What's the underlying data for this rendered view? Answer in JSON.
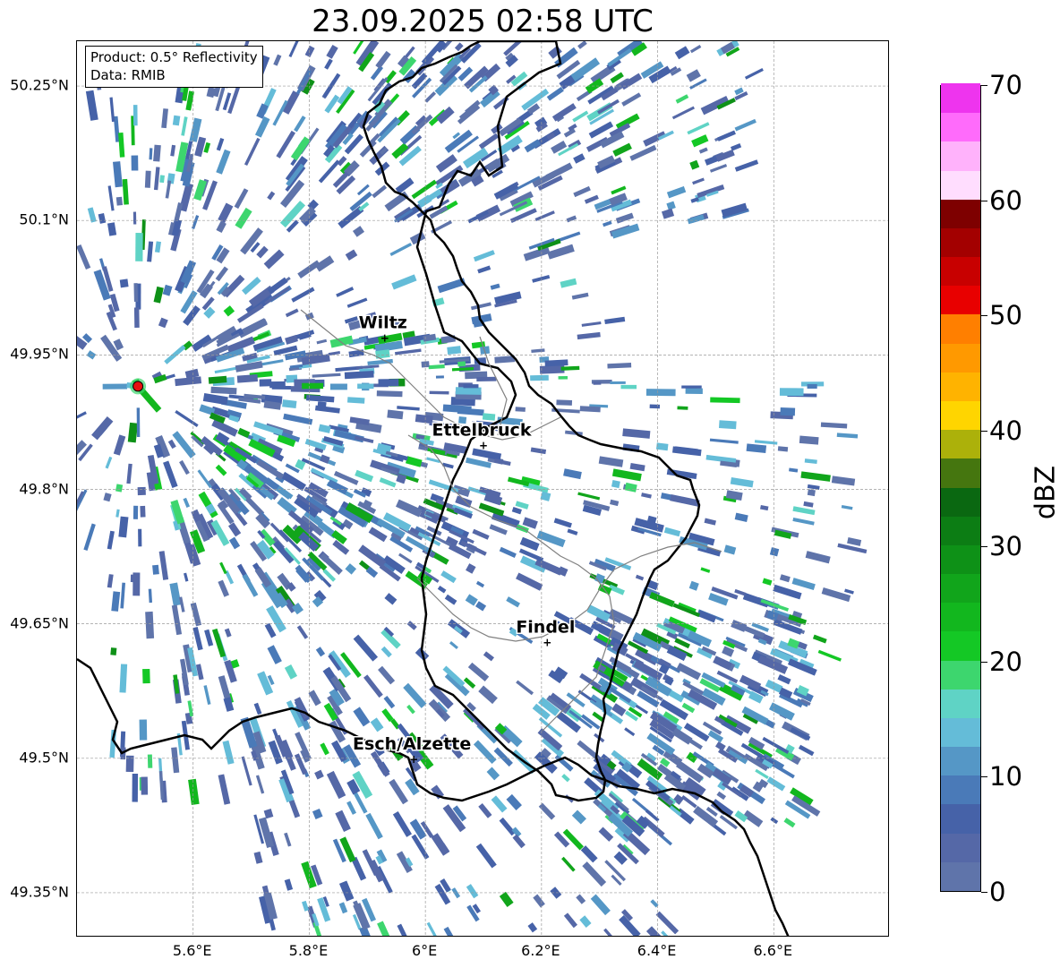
{
  "title": "23.09.2025 02:58 UTC",
  "info_box": {
    "product": "Product: 0.5° Reflectivity",
    "data": "Data: RMIB"
  },
  "axes": {
    "lat_ticks": [
      "50.25°N",
      "50.1°N",
      "49.95°N",
      "49.8°N",
      "49.65°N",
      "49.5°N",
      "49.35°N"
    ],
    "lon_ticks": [
      "5.6°E",
      "5.8°E",
      "6°E",
      "6.2°E",
      "6.4°E",
      "6.6°E"
    ],
    "lat_range": [
      49.3,
      50.3
    ],
    "lon_range": [
      5.4,
      6.8
    ],
    "grid": true
  },
  "cities": [
    {
      "name": "Wiltz",
      "lon": 5.93,
      "lat": 49.97
    },
    {
      "name": "Ettelbruck",
      "lon": 6.1,
      "lat": 49.85
    },
    {
      "name": "Findel",
      "lon": 6.21,
      "lat": 49.63
    },
    {
      "name": "Esch/Alzette",
      "lon": 5.98,
      "lat": 49.5
    }
  ],
  "radar_site": {
    "name": "radar-site",
    "lon": 5.505,
    "lat": 49.915
  },
  "colorbar": {
    "label": "dBZ",
    "min": 0,
    "max": 70,
    "step": 2.5,
    "tick_labels": [
      "0",
      "10",
      "20",
      "30",
      "40",
      "50",
      "60",
      "70"
    ],
    "tick_values": [
      0,
      10,
      20,
      30,
      40,
      50,
      60,
      70
    ],
    "colors": [
      "#5f74aa",
      "#5568a7",
      "#4662a8",
      "#4a7ab8",
      "#5597c6",
      "#64bcd8",
      "#5fd3c5",
      "#3dd66e",
      "#14c825",
      "#12b71e",
      "#11a51b",
      "#0e9117",
      "#0c7d14",
      "#0a6811",
      "#45760f",
      "#acb10a",
      "#ffd500",
      "#ffb300",
      "#ff9900",
      "#ff7f00",
      "#e80000",
      "#c80000",
      "#a30000",
      "#7e0000",
      "#ffddfe",
      "#ffb2fb",
      "#ff6bfb",
      "#ee34ee"
    ]
  }
}
